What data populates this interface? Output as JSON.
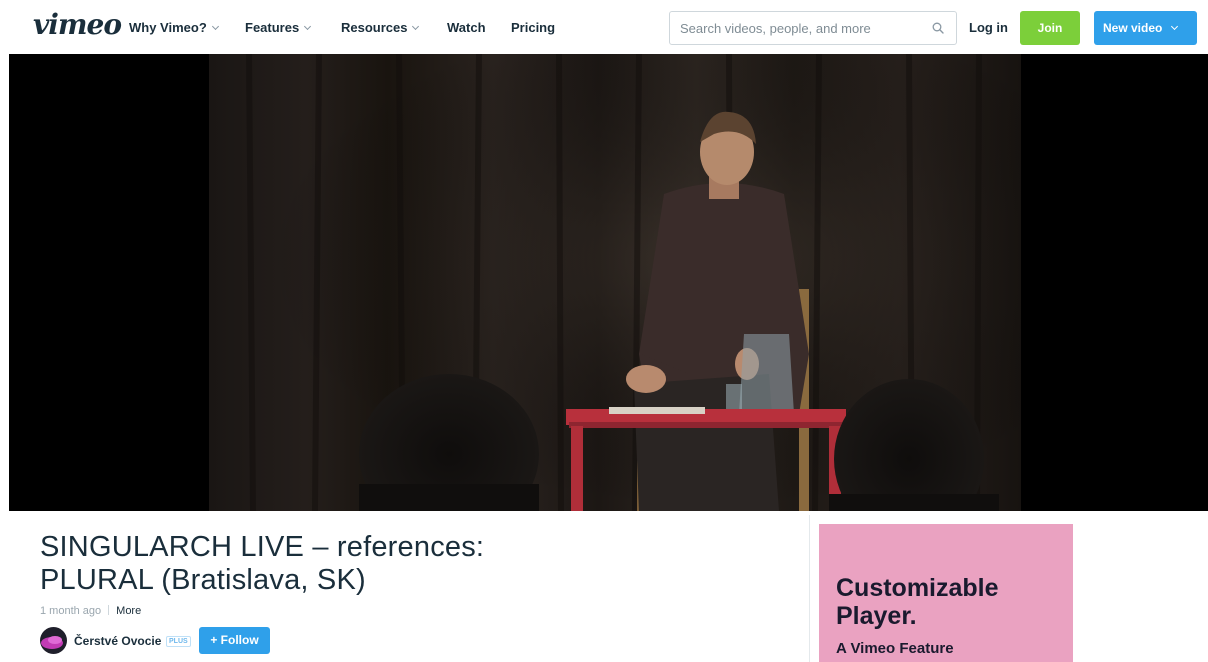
{
  "nav": {
    "logo": "vimeo",
    "items": [
      {
        "label": "Why Vimeo?",
        "dropdown": true
      },
      {
        "label": "Features",
        "dropdown": true
      },
      {
        "label": "Resources",
        "dropdown": true
      },
      {
        "label": "Watch",
        "dropdown": false
      },
      {
        "label": "Pricing",
        "dropdown": false
      }
    ],
    "search": {
      "placeholder": "Search videos, people, and more",
      "value": ""
    },
    "login": "Log in",
    "join": "Join",
    "new_video": "New video"
  },
  "video": {
    "title": "SINGULARCH LIVE – references: PLURAL (Bratislava, SK)",
    "posted": "1 month ago",
    "more": "More",
    "channel": {
      "name": "Čerstvé Ovocie",
      "badge": "PLUS",
      "follow": "+ Follow"
    }
  },
  "ad": {
    "title": "Customizable Player.",
    "subtitle": "A Vimeo Feature"
  },
  "colors": {
    "brand_text": "#1a2e3b",
    "join": "#7ccf3a",
    "accent_blue": "#2fa0ea",
    "ad_background": "#eaa2c1"
  },
  "icons": [
    "search-icon",
    "chevron-down-icon"
  ]
}
